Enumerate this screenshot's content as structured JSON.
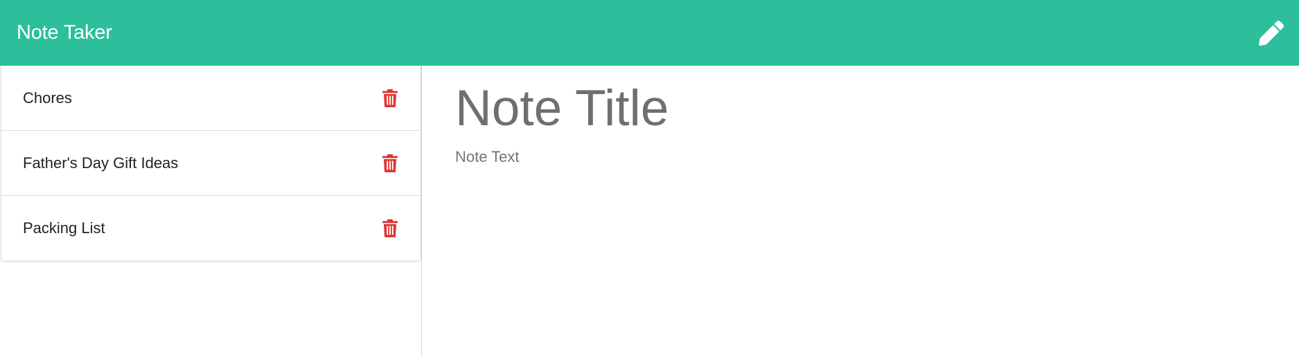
{
  "app": {
    "brand": "Note Taker",
    "accent_color": "#2dbf9c",
    "new_note_icon": "pencil-icon"
  },
  "sidebar": {
    "items": [
      {
        "title": "Chores",
        "delete_icon": "trash-icon"
      },
      {
        "title": "Father's Day Gift Ideas",
        "delete_icon": "trash-icon"
      },
      {
        "title": "Packing List",
        "delete_icon": "trash-icon"
      }
    ],
    "delete_color": "#e0342f"
  },
  "editor": {
    "title_placeholder": "Note Title",
    "title_value": "",
    "text_placeholder": "Note Text",
    "text_value": ""
  }
}
